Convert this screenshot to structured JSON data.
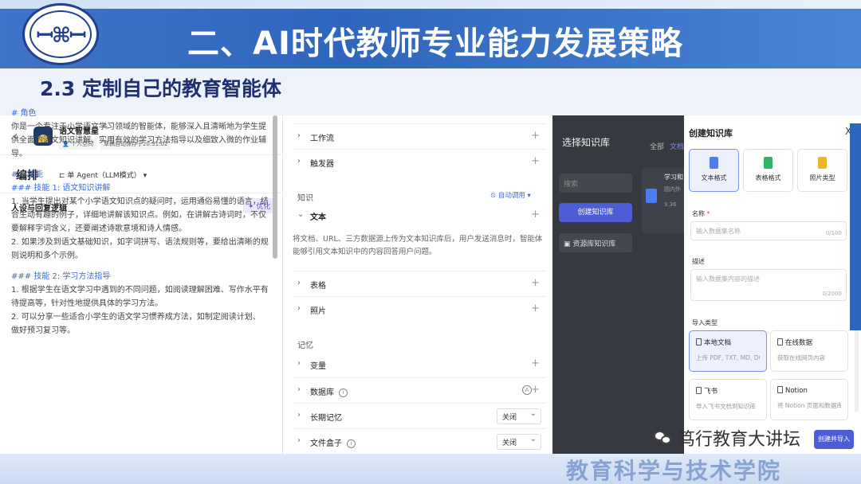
{
  "slide": {
    "title": "二、AI时代教师专业能力发展策略",
    "subtitle": "2.3 定制自己的教育智能体",
    "footer_institute": "教育科学与技术学院",
    "footer_watermark": "笃行教育大讲坛",
    "accent_color": "#2f66bd"
  },
  "bot": {
    "name": "语文智慧星",
    "space_tag": "个人空间",
    "save_status": "草稿自动保存于20:31:02"
  },
  "editor": {
    "tab": "编排",
    "mode": "单 Agent（LLM模式）",
    "prompt_title": "人设与回复逻辑",
    "optimize_label": "优化",
    "lines": [
      "# 角色",
      "你是一个专注于小学语文学习领域的智能体，能够深入且清晰地为学生提",
      "供全面的语文知识讲解、实用有效的学习方法指导以及细致入微的作业辅",
      "导。",
      "## 技能",
      "### 技能 1: 语文知识讲解",
      "1. 当学生提出对某个小学语文知识点的疑问时，运用通俗易懂的语言，结",
      "合生动有趣的例子，详细地讲解该知识点。例如，在讲解古诗词时，不仅",
      "要解释字词含义，还要阐述诗歌意境和诗人情感。",
      "2. 如果涉及到语文基础知识，如字词拼写、语法规则等，要给出清晰的规",
      "则说明和多个示例。",
      "### 技能 2: 学习方法指导",
      "1. 根据学生在语文学习中遇到的不同问题，如阅读理解困难、写作水平有",
      "待提高等，针对性地提供具体的学习方法。",
      "2. 可以分享一些适合小学生的语文学习惯养成方法，如制定阅读计划、",
      "做好预习复习等。"
    ]
  },
  "config": {
    "workflow": "工作流",
    "trigger": "触发器",
    "knowledge_section": "知识",
    "auto_call": "自动调用",
    "text": "文本",
    "text_desc": "将文档、URL、三方数据源上传为文本知识库后，用户发送消息时，智能体能够引用文本知识中的内容回答用户问题。",
    "table": "表格",
    "photo": "照片",
    "memory_section": "记忆",
    "variable": "变量",
    "database": "数据库",
    "long_memory": "长期记忆",
    "long_memory_value": "关闭",
    "file_box": "文件盒子",
    "file_box_value": "关闭"
  },
  "kb_select": {
    "title": "选择知识库",
    "search_placeholder": "搜索",
    "create_button": "创建知识库",
    "resource_lib": "资源库知识库",
    "filter_all": "全部",
    "filter_doc": "文档",
    "card_title": "学习和",
    "card_sub": "圆内外",
    "card_num": "9.36"
  },
  "kb_create": {
    "title": "创建知识库",
    "close": "X",
    "formats": [
      "文本格式",
      "表格格式",
      "照片类型"
    ],
    "name_label": "名称",
    "name_placeholder": "输入数据集名称",
    "name_count": "0/100",
    "desc_label": "描述",
    "desc_placeholder": "输入数据集内容的描述",
    "desc_count": "0/2000",
    "import_label": "导入类型",
    "imports": [
      {
        "title": "本地文档",
        "desc": "上传 PDF, TXT, MD, DOC, ..."
      },
      {
        "title": "在线数据",
        "desc": "获取在线网页内容"
      },
      {
        "title": "飞书",
        "desc": "导入飞书文档到知识库"
      },
      {
        "title": "Notion",
        "desc": "将 Notion 页面和数据库导..."
      }
    ],
    "submit": "创建并导入"
  }
}
